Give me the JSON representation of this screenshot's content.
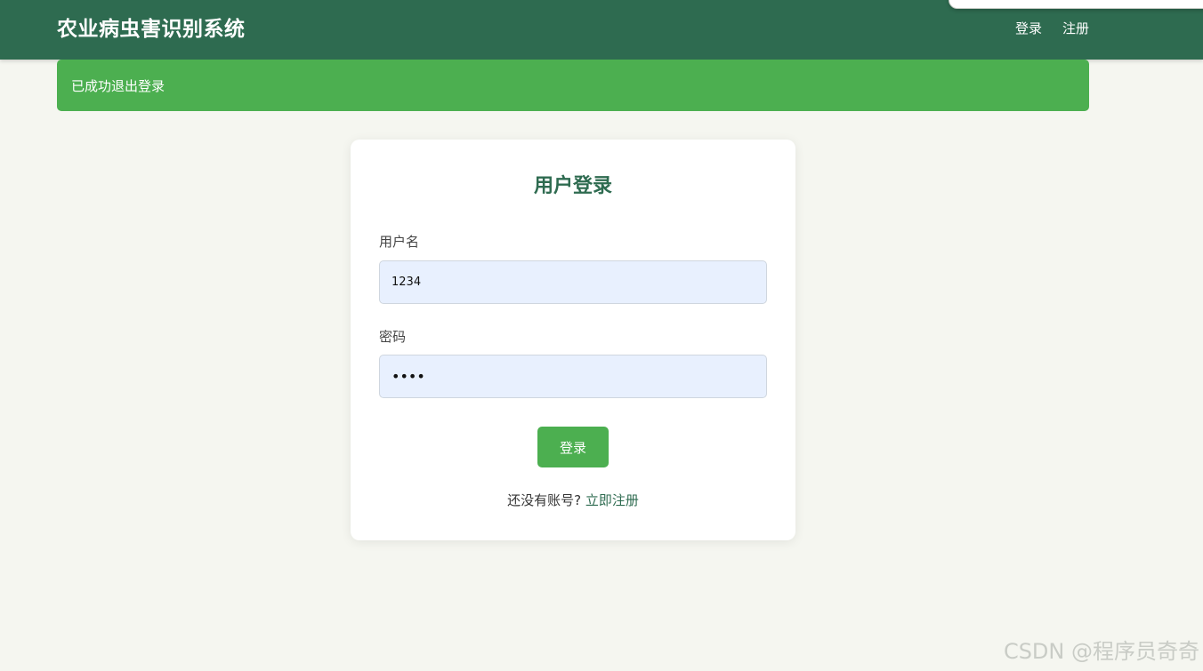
{
  "header": {
    "title": "农业病虫害识别系统",
    "nav": {
      "login": "登录",
      "register": "注册"
    }
  },
  "alert": {
    "message": "已成功退出登录"
  },
  "login_card": {
    "title": "用户登录",
    "username_label": "用户名",
    "username_value": "1234",
    "password_label": "密码",
    "password_value": "1234",
    "submit_label": "登录",
    "no_account_text": "还没有账号?",
    "register_link": "立即注册"
  },
  "watermark": "CSDN @程序员奇奇",
  "colors": {
    "header_bg": "#2e6b50",
    "accent": "#4caf50",
    "page_bg": "#f5f6f0",
    "input_bg": "#e8f0fe"
  }
}
